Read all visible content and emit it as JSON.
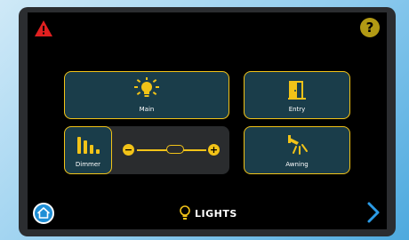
{
  "colors": {
    "accent": "#f2c318",
    "tile_bg": "#1a3d4a",
    "screen_bg": "#000000",
    "home_blue": "#1f8fd6",
    "warning_red": "#e02020"
  },
  "header": {
    "warning_icon": "warning-triangle-icon",
    "help_label": "?"
  },
  "tiles": {
    "main": {
      "label": "Main",
      "icon": "lightbulb-icon"
    },
    "entry": {
      "label": "Entry",
      "icon": "door-icon"
    },
    "awning": {
      "label": "Awning",
      "icon": "awning-light-icon"
    }
  },
  "dimmer": {
    "label": "Dimmer",
    "icon": "dimmer-bars-icon",
    "minus": "−",
    "plus": "+",
    "level": 0.55
  },
  "footer": {
    "home_icon": "home-icon",
    "title": "LIGHTS",
    "title_icon": "lightbulb-outline-icon",
    "next_icon": "chevron-right-icon"
  }
}
